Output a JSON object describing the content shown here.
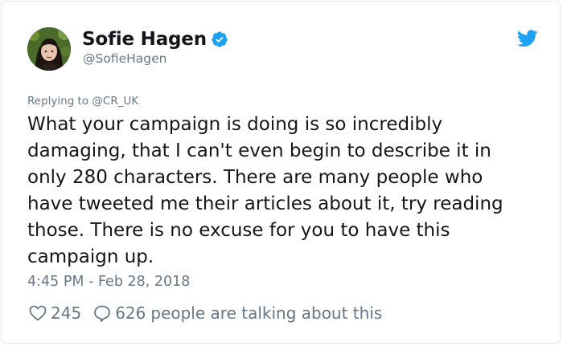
{
  "author": {
    "display_name": "Sofie Hagen",
    "handle": "@SofieHagen",
    "verified": true
  },
  "reply": {
    "prefix": "Replying to",
    "target": "@CR_UK"
  },
  "tweet": {
    "text": "What your campaign is doing is so incredibly\ndamaging, that I can't even begin to describe it in\nonly 280 characters. There are many people who\nhave tweeted me their articles about it, try reading\nthose. There is no excuse for you to have this\ncampaign up.",
    "timestamp": "4:45 PM - Feb 28, 2018"
  },
  "stats": {
    "likes": "245",
    "replies": "626",
    "talking_label": "people are talking about this"
  },
  "icons": {
    "verified": "verified-badge-icon",
    "bird": "twitter-bird-icon",
    "like": "heart-icon",
    "reply": "speech-bubble-icon"
  },
  "colors": {
    "brand": "#1da1f2",
    "text": "#14171a",
    "muted": "#657786",
    "border": "#e1e8ed"
  }
}
